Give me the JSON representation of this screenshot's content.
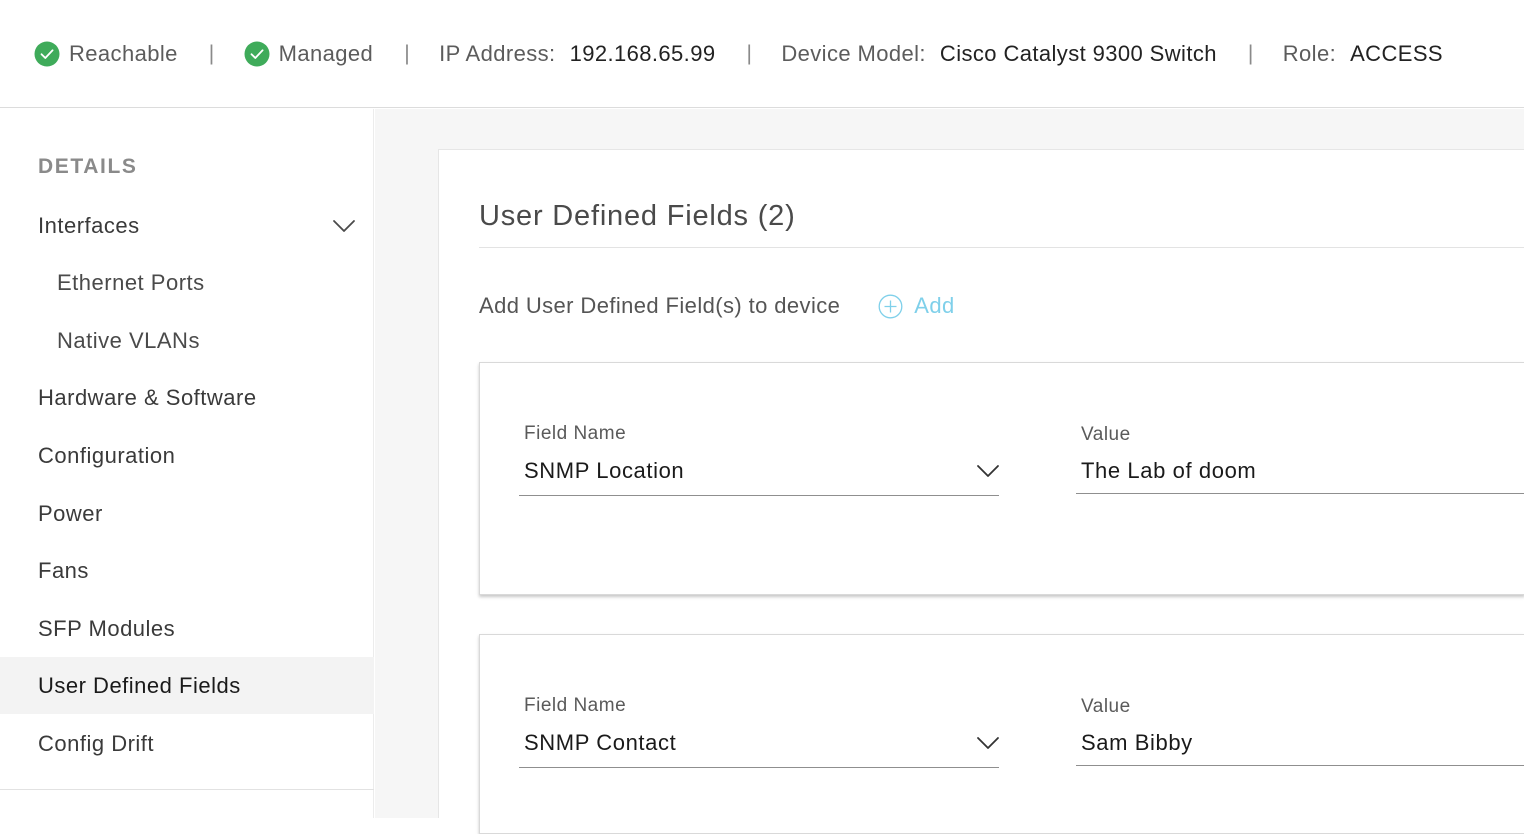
{
  "status_bar": {
    "reachable": "Reachable",
    "managed": "Managed",
    "separator": "|",
    "ip_label": "IP Address:",
    "ip_value": "192.168.65.99",
    "model_label": "Device Model:",
    "model_value": "Cisco Catalyst 9300 Switch",
    "role_label": "Role:",
    "role_value": "ACCESS",
    "status_color": "#3fab5a",
    "icons": [
      "check-circle-icon",
      "check-circle-icon"
    ]
  },
  "sidebar": {
    "heading": "DETAILS",
    "items": [
      {
        "label": "Interfaces",
        "icon": "chevron-down-icon"
      },
      {
        "label": "Ethernet Ports"
      },
      {
        "label": "Native VLANs"
      },
      {
        "label": "Hardware & Software"
      },
      {
        "label": "Configuration"
      },
      {
        "label": "Power"
      },
      {
        "label": "Fans"
      },
      {
        "label": "SFP Modules"
      },
      {
        "label": "User Defined Fields",
        "active": true
      },
      {
        "label": "Config Drift"
      }
    ]
  },
  "main": {
    "title": "User Defined Fields (2)",
    "add_prompt": "Add User Defined Field(s) to device",
    "add_label": "Add",
    "add_icon": "plus-circle-icon",
    "accent_color": "#7fd0ea",
    "fields": [
      {
        "name_label": "Field Name",
        "name_value": "SNMP Location",
        "value_label": "Value",
        "value": "The Lab of doom"
      },
      {
        "name_label": "Field Name",
        "name_value": "SNMP Contact",
        "value_label": "Value",
        "value": "Sam Bibby"
      }
    ]
  }
}
